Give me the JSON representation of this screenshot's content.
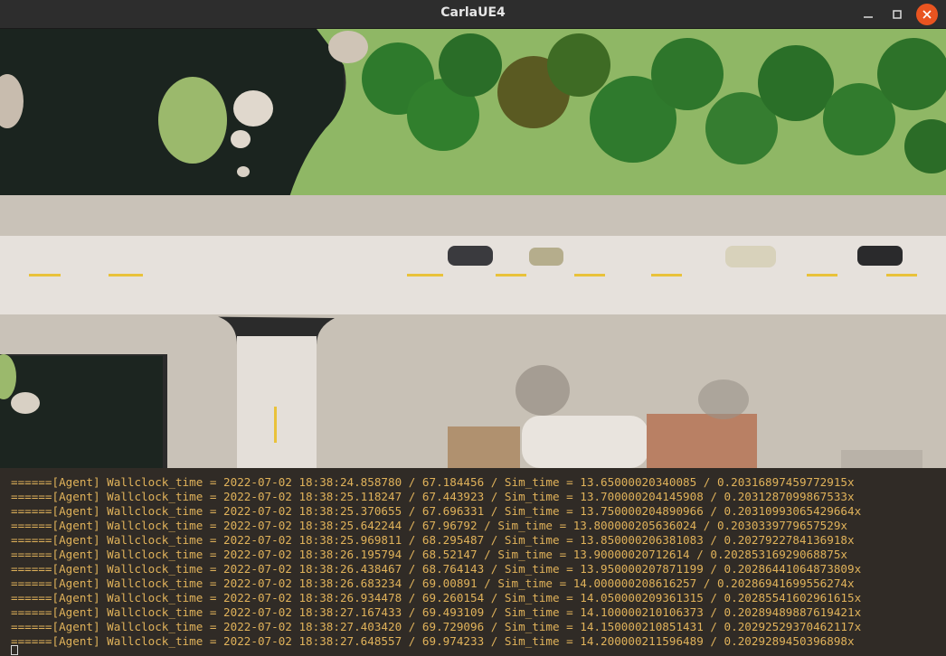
{
  "window": {
    "title": "CarlaUE4"
  },
  "controls": {
    "minimize": "minimize",
    "maximize": "maximize",
    "close": "close"
  },
  "viewport": {
    "scene": "top-down simulation view"
  },
  "terminal": {
    "lines": [
      "======[Agent] Wallclock_time = 2022-07-02 18:38:24.858780 / 67.184456 / Sim_time = 13.65000020340085 / 0.20316897459772915x",
      "======[Agent] Wallclock_time = 2022-07-02 18:38:25.118247 / 67.443923 / Sim_time = 13.700000204145908 / 0.2031287099867533x",
      "======[Agent] Wallclock_time = 2022-07-02 18:38:25.370655 / 67.696331 / Sim_time = 13.750000204890966 / 0.20310993065429664x",
      "======[Agent] Wallclock_time = 2022-07-02 18:38:25.642244 / 67.96792 / Sim_time = 13.800000205636024 / 0.2030339779657529x",
      "======[Agent] Wallclock_time = 2022-07-02 18:38:25.969811 / 68.295487 / Sim_time = 13.850000206381083 / 0.2027922784136918x",
      "======[Agent] Wallclock_time = 2022-07-02 18:38:26.195794 / 68.52147 / Sim_time = 13.90000020712614 / 0.20285316929068875x",
      "======[Agent] Wallclock_time = 2022-07-02 18:38:26.438467 / 68.764143 / Sim_time = 13.950000207871199 / 0.20286441064873809x",
      "======[Agent] Wallclock_time = 2022-07-02 18:38:26.683234 / 69.00891 / Sim_time = 14.000000208616257 / 0.20286941699556274x",
      "======[Agent] Wallclock_time = 2022-07-02 18:38:26.934478 / 69.260154 / Sim_time = 14.050000209361315 / 0.20285541602961615x",
      "======[Agent] Wallclock_time = 2022-07-02 18:38:27.167433 / 69.493109 / Sim_time = 14.100000210106373 / 0.20289489887619421x",
      "======[Agent] Wallclock_time = 2022-07-02 18:38:27.403420 / 69.729096 / Sim_time = 14.150000210851431 / 0.20292529370462117x",
      "======[Agent] Wallclock_time = 2022-07-02 18:38:27.648557 / 69.974233 / Sim_time = 14.200000211596489 / 0.2029289450396898x"
    ]
  }
}
